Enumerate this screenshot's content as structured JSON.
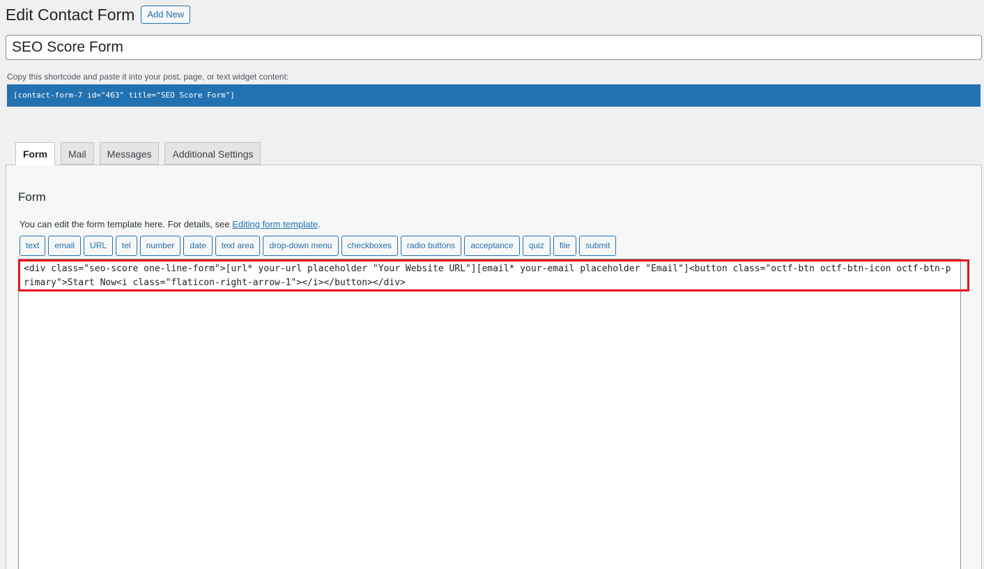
{
  "header": {
    "title": "Edit Contact Form",
    "add_new_label": "Add New"
  },
  "form_title": {
    "value": "SEO Score Form"
  },
  "shortcode": {
    "note": "Copy this shortcode and paste it into your post, page, or text widget content:",
    "value": "[contact-form-7 id=\"463\" title=\"SEO Score Form\"]"
  },
  "tabs": [
    {
      "label": "Form",
      "active": true
    },
    {
      "label": "Mail",
      "active": false
    },
    {
      "label": "Messages",
      "active": false
    },
    {
      "label": "Additional Settings",
      "active": false
    }
  ],
  "form_panel": {
    "title": "Form",
    "description_prefix": "You can edit the form template here. For details, see ",
    "description_link": "Editing form template",
    "description_suffix": ".",
    "tag_buttons": [
      "text",
      "email",
      "URL",
      "tel",
      "number",
      "date",
      "text area",
      "drop-down menu",
      "checkboxes",
      "radio buttons",
      "acceptance",
      "quiz",
      "file",
      "submit"
    ],
    "template_value": "<div class=\"seo-score one-line-form\">[url* your-url placeholder \"Your Website URL\"][email* your-email placeholder \"Email\"]<button class=\"octf-btn octf-btn-icon octf-btn-primary\">Start Now<i class=\"flaticon-right-arrow-1\"></i></button></div>"
  },
  "colors": {
    "accent": "#2271b1",
    "highlight": "#e3131b",
    "background": "#f0f0f1"
  }
}
